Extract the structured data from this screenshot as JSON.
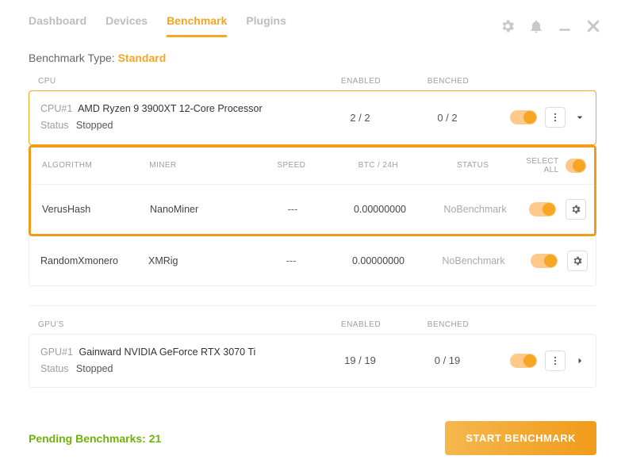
{
  "nav": {
    "tabs": [
      "Dashboard",
      "Devices",
      "Benchmark",
      "Plugins"
    ],
    "active_index": 2
  },
  "benchmark_type": {
    "label": "Benchmark Type:",
    "value": "Standard"
  },
  "section_headers": {
    "enabled": "ENABLED",
    "benched": "BENCHED"
  },
  "cpu": {
    "header": "CPU",
    "id": "CPU#1",
    "name": "AMD Ryzen 9 3900XT 12-Core Processor",
    "status_label": "Status",
    "status_value": "Stopped",
    "enabled": "2 / 2",
    "benched": "0 / 2"
  },
  "alg_headers": {
    "algorithm": "ALGORITHM",
    "miner": "MINER",
    "speed": "SPEED",
    "btc24h": "BTC / 24H",
    "status": "STATUS",
    "select_all": "SELECT ALL"
  },
  "alg_rows": [
    {
      "algorithm": "VerusHash",
      "miner": "NanoMiner",
      "speed": "---",
      "btc24h": "0.00000000",
      "status": "NoBenchmark"
    },
    {
      "algorithm": "RandomXmonero",
      "miner": "XMRig",
      "speed": "---",
      "btc24h": "0.00000000",
      "status": "NoBenchmark"
    }
  ],
  "gpu": {
    "header": "GPU'S",
    "id": "GPU#1",
    "name": "Gainward NVIDIA GeForce RTX 3070 Ti",
    "status_label": "Status",
    "status_value": "Stopped",
    "enabled": "19 / 19",
    "benched": "0 / 19"
  },
  "footer": {
    "pending": "Pending Benchmarks: 21",
    "start": "START BENCHMARK"
  }
}
